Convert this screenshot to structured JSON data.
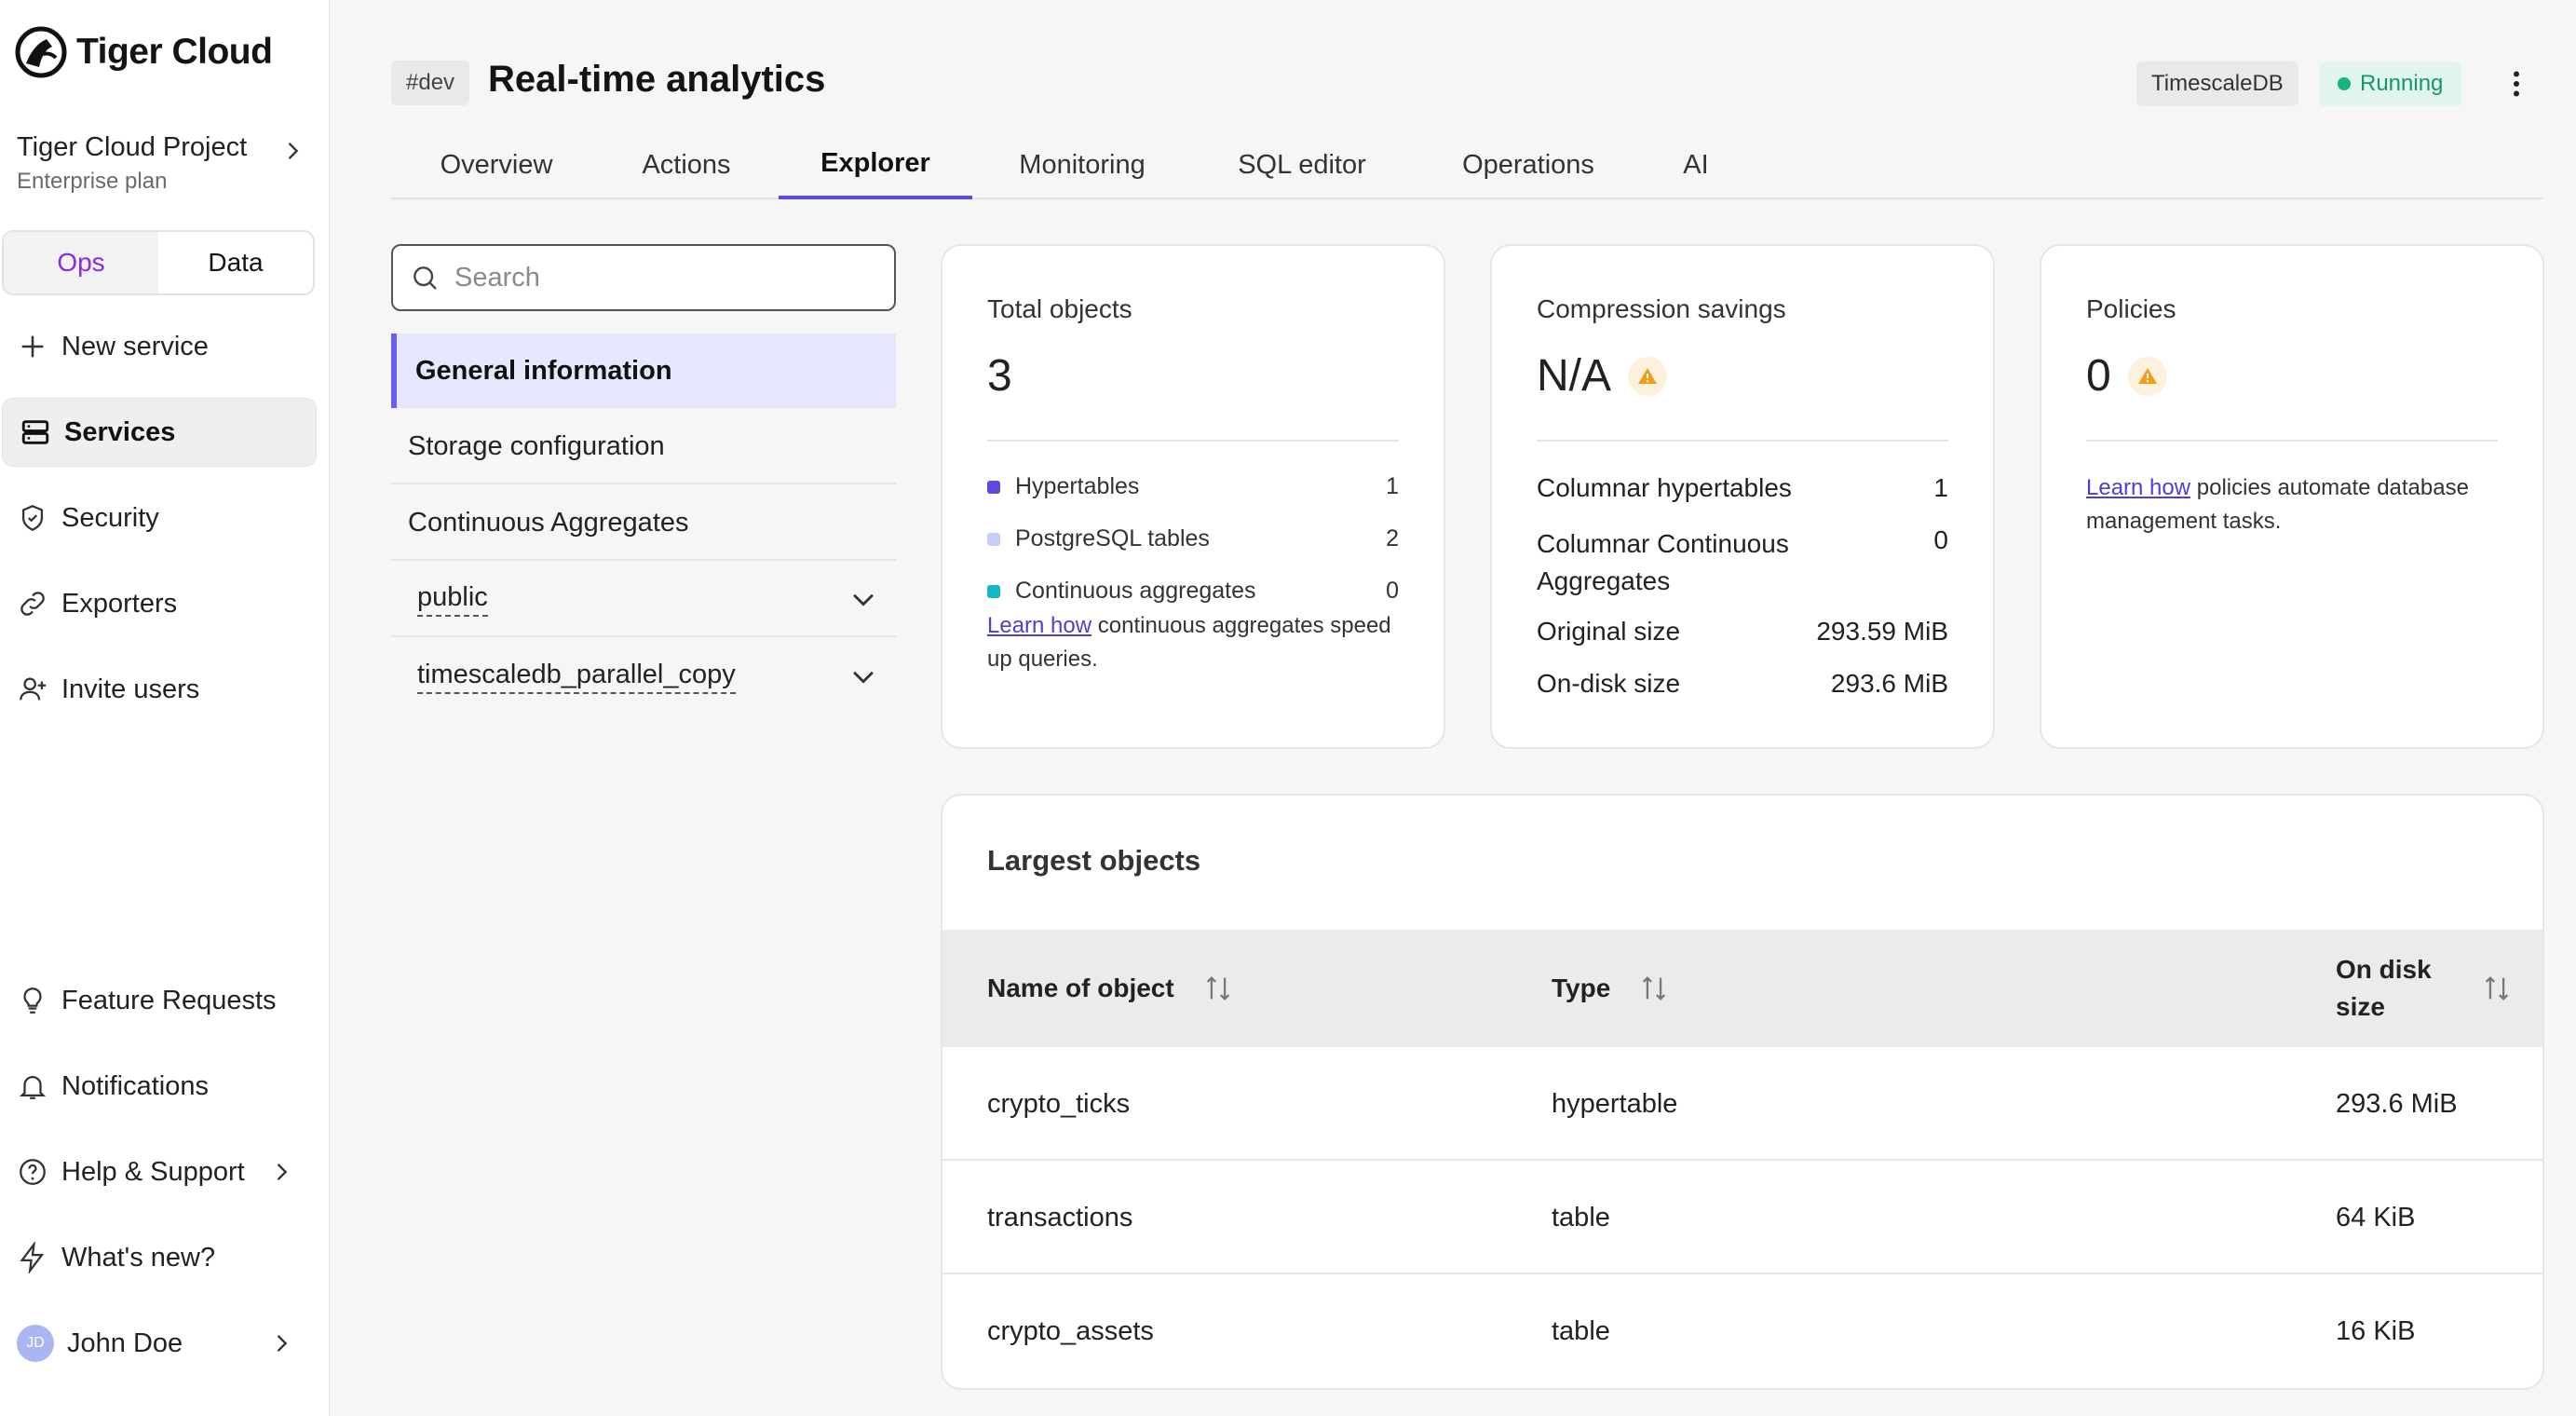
{
  "app": {
    "name": "Tiger Cloud"
  },
  "project": {
    "name": "Tiger Cloud Project",
    "plan": "Enterprise plan"
  },
  "mode_toggle": {
    "ops": "Ops",
    "data": "Data",
    "selected": "Ops"
  },
  "sidebar": {
    "items": [
      {
        "label": "New service",
        "icon": "plus-icon"
      },
      {
        "label": "Services",
        "icon": "server-icon",
        "active": true
      },
      {
        "label": "Security",
        "icon": "shield-check-icon"
      },
      {
        "label": "Exporters",
        "icon": "link-icon"
      },
      {
        "label": "Invite users",
        "icon": "user-plus-icon"
      }
    ],
    "bottom": [
      {
        "label": "Feature Requests",
        "icon": "lightbulb-icon"
      },
      {
        "label": "Notifications",
        "icon": "bell-icon"
      },
      {
        "label": "Help & Support",
        "icon": "help-circle-icon"
      },
      {
        "label": "What's new?",
        "icon": "zap-icon"
      }
    ],
    "user": {
      "name": "John Doe",
      "initials": "JD"
    }
  },
  "header": {
    "tag": "#dev",
    "title": "Real-time analytics",
    "db_type": "TimescaleDB",
    "status": "Running"
  },
  "tabs": [
    "Overview",
    "Actions",
    "Explorer",
    "Monitoring",
    "SQL editor",
    "Operations",
    "AI"
  ],
  "active_tab": "Explorer",
  "explorer": {
    "search_placeholder": "Search",
    "menu": [
      "General information",
      "Storage configuration",
      "Continuous Aggregates"
    ],
    "schemas": [
      "public",
      "timescaledb_parallel_copy"
    ]
  },
  "total_objects": {
    "label": "Total objects",
    "value": "3",
    "rows": [
      {
        "label": "Hypertables",
        "value": "1",
        "color": "#5b4ce0"
      },
      {
        "label": "PostgreSQL tables",
        "value": "2",
        "color": "#c8cdf6"
      },
      {
        "label": "Continuous aggregates",
        "value": "0",
        "color": "#15b9c4"
      }
    ],
    "note_link": "Learn how",
    "note_text": "continuous aggregates speed up queries."
  },
  "compression": {
    "label": "Compression savings",
    "value": "N/A",
    "rows": [
      {
        "label": "Columnar hypertables",
        "value": "1"
      },
      {
        "label": "Columnar Continuous Aggregates",
        "value": "0"
      },
      {
        "label": "Original size",
        "value": "293.59 MiB"
      },
      {
        "label": "On-disk size",
        "value": "293.6 MiB"
      }
    ]
  },
  "policies": {
    "label": "Policies",
    "value": "0",
    "note_link": "Learn how",
    "note_text": "policies automate database management tasks."
  },
  "largest_objects": {
    "title": "Largest objects",
    "columns": [
      "Name of object",
      "Type",
      "On disk size"
    ],
    "rows": [
      {
        "name": "crypto_ticks",
        "type": "hypertable",
        "size": "293.6 MiB"
      },
      {
        "name": "transactions",
        "type": "table",
        "size": "64 KiB"
      },
      {
        "name": "crypto_assets",
        "type": "table",
        "size": "16 KiB"
      }
    ]
  }
}
